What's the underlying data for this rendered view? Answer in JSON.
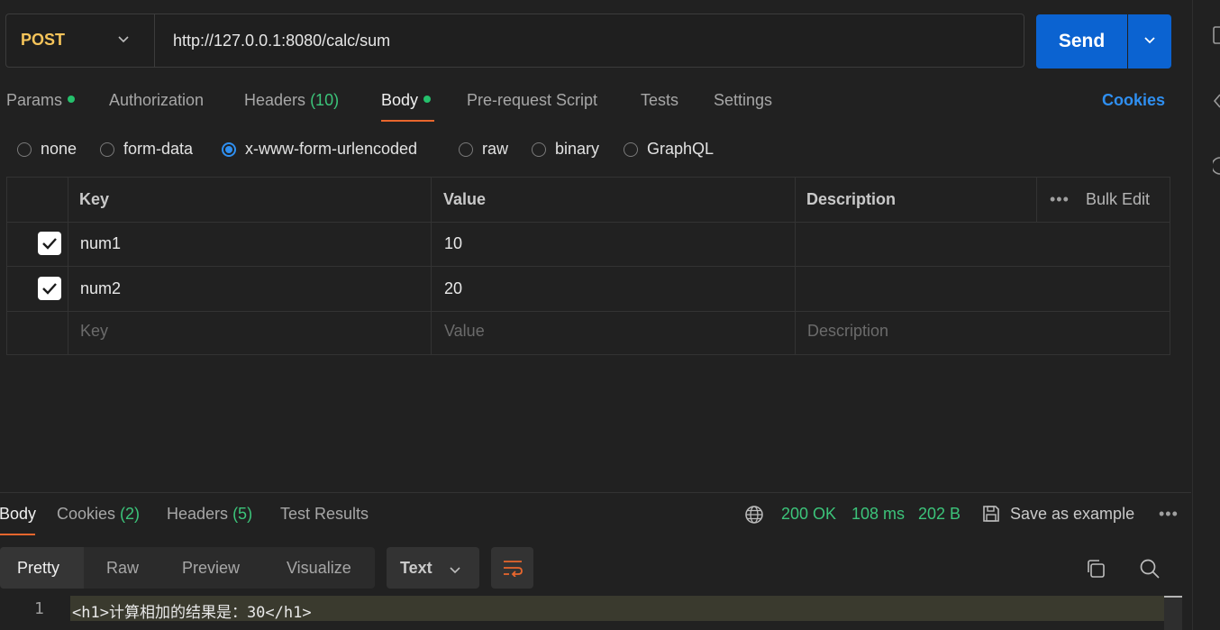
{
  "request": {
    "method": "POST",
    "url": "http://127.0.0.1:8080/calc/sum",
    "send_label": "Send"
  },
  "tabs": {
    "params": "Params",
    "authorization": "Authorization",
    "headers": "Headers",
    "headers_count": "(10)",
    "body": "Body",
    "prerequest": "Pre-request Script",
    "tests": "Tests",
    "settings": "Settings",
    "cookies": "Cookies"
  },
  "body_types": {
    "none": "none",
    "form_data": "form-data",
    "urlencoded": "x-www-form-urlencoded",
    "raw": "raw",
    "binary": "binary",
    "graphql": "GraphQL",
    "selected": "x-www-form-urlencoded"
  },
  "table": {
    "headers": {
      "key": "Key",
      "value": "Value",
      "description": "Description"
    },
    "bulk_edit": "Bulk Edit",
    "more": "•••",
    "rows": [
      {
        "key": "num1",
        "value": "10",
        "checked": true
      },
      {
        "key": "num2",
        "value": "20",
        "checked": true
      }
    ],
    "placeholders": {
      "key": "Key",
      "value": "Value",
      "description": "Description"
    }
  },
  "response": {
    "tabs": {
      "body": "Body",
      "cookies": "Cookies",
      "cookies_count": "(2)",
      "headers": "Headers",
      "headers_count": "(5)",
      "tests": "Test Results"
    },
    "status": "200 OK",
    "time": "108 ms",
    "size": "202 B",
    "save_label": "Save as example",
    "more": "•••",
    "views": {
      "pretty": "Pretty",
      "raw": "Raw",
      "preview": "Preview",
      "visualize": "Visualize"
    },
    "format": "Text",
    "lines": [
      {
        "no": "1",
        "text": "<h1>计算相加的结果是：30</h1>"
      }
    ]
  },
  "colors": {
    "accent": "#0b63d1",
    "method": "#f5c45a",
    "success": "#3cc47a",
    "link": "#2f8ff0",
    "tab_underline": "#e8662d"
  }
}
